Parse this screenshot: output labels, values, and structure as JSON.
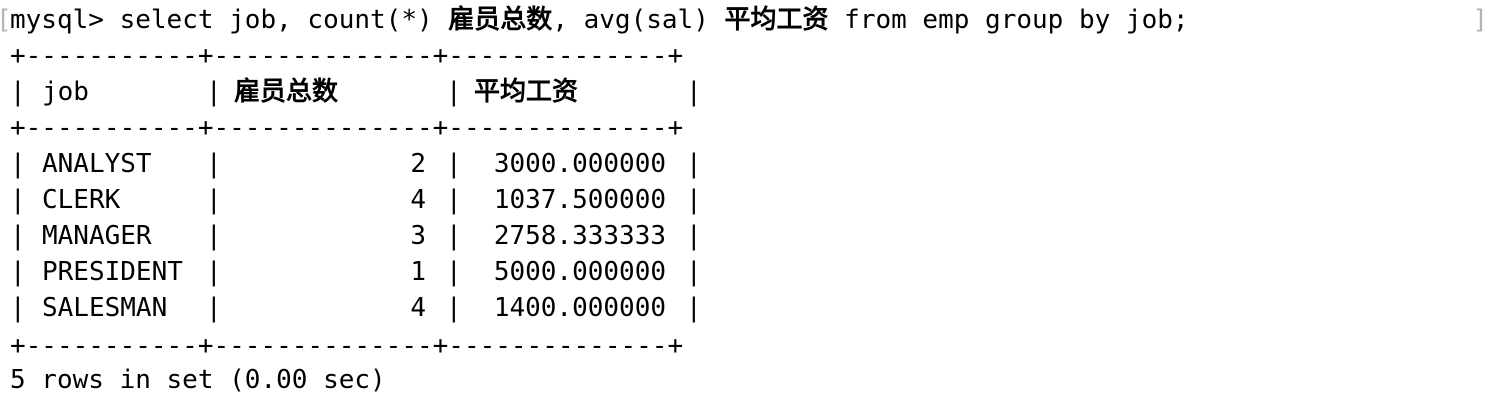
{
  "window": {
    "left_bracket": "[",
    "right_bracket": "]"
  },
  "prompt": {
    "label": "mysql>",
    "query_part1": " select job, count(*) ",
    "alias1": "雇员总数",
    "query_part2": ", avg(sal) ",
    "alias2": "平均工资",
    "query_part3": " from emp group by job;"
  },
  "table": {
    "border": "+-----------+--------------+--------------+",
    "pipe": "|",
    "columns": [
      "job",
      "雇员总数",
      "平均工资"
    ],
    "rows": [
      {
        "job": "ANALYST",
        "count": "2",
        "avg": "3000.000000"
      },
      {
        "job": "CLERK",
        "count": "4",
        "avg": "1037.500000"
      },
      {
        "job": "MANAGER",
        "count": "3",
        "avg": "2758.333333"
      },
      {
        "job": "PRESIDENT",
        "count": "1",
        "avg": "5000.000000"
      },
      {
        "job": "SALESMAN",
        "count": "4",
        "avg": "1400.000000"
      }
    ]
  },
  "status": "5 rows in set (0.00 sec)"
}
